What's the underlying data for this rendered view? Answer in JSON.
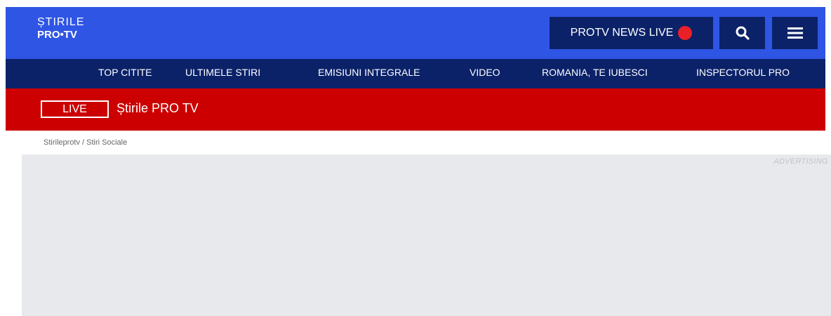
{
  "header": {
    "logo_line1": "ȘTIRILE",
    "logo_line2": "PRO•TV",
    "live_button_label": "PROTV NEWS LIVE",
    "colors": {
      "header_bg": "#2f55e4",
      "button_bg": "#0b2269",
      "live_dot": "#ea2027"
    },
    "icons": [
      "search-icon",
      "hamburger-menu-icon"
    ]
  },
  "nav": {
    "items": [
      {
        "label": "TOP CITITE"
      },
      {
        "label": "ULTIMELE STIRI"
      },
      {
        "label": "EMISIUNI INTEGRALE"
      },
      {
        "label": "VIDEO"
      },
      {
        "label": "ROMANIA, TE IUBESCI"
      },
      {
        "label": "INSPECTORUL PRO"
      }
    ]
  },
  "live_bar": {
    "tag": "LIVE",
    "title": "Știrile PRO TV",
    "color": "#cc0000"
  },
  "breadcrumb": {
    "text": "Stirileprotv / Stiri Sociale"
  },
  "ad": {
    "label": "ADVERTISING"
  }
}
